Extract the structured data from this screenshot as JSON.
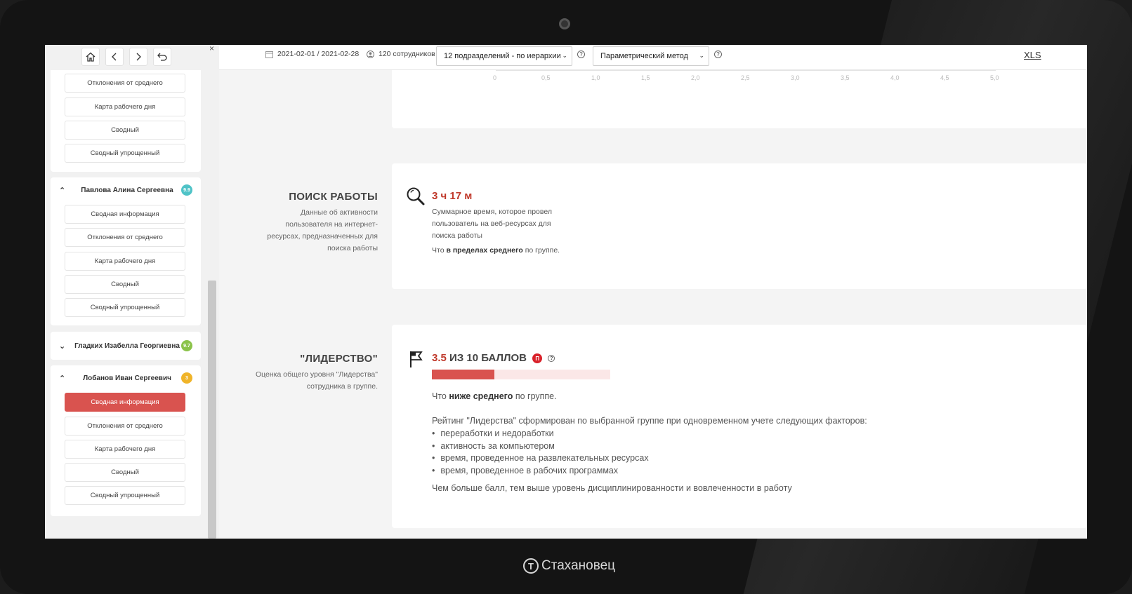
{
  "brand": {
    "name": "Стахановец"
  },
  "sidebar": {
    "cards": [
      {
        "items": [
          "Отклонения от среднего",
          "Карта рабочего дня",
          "Сводный",
          "Сводный упрощенный"
        ]
      },
      {
        "name": "Павлова Алина Сергеевна",
        "score": "9.9",
        "badge_color": "#4fc3c7",
        "expanded": true,
        "items": [
          "Сводная информация",
          "Отклонения от среднего",
          "Карта рабочего дня",
          "Сводный",
          "Сводный упрощенный"
        ]
      },
      {
        "name": "Гладких Изабелла Георгиевна",
        "score": "9.7",
        "badge_color": "#8bc34a",
        "expanded": false,
        "items": []
      },
      {
        "name": "Лобанов Иван Сергеевич",
        "score": "3",
        "badge_color": "#f0b429",
        "expanded": true,
        "items": [
          "Сводная информация",
          "Отклонения от среднего",
          "Карта рабочего дня",
          "Сводный",
          "Сводный упрощенный"
        ],
        "active_index": 0
      }
    ]
  },
  "topbar": {
    "period": "2021-02-01 / 2021-02-28",
    "employees": "120 сотрудников",
    "division_select": "12 подразделений - по иерархии",
    "method_select": "Параметрический метод",
    "export": "XLS"
  },
  "axis_ticks": [
    "0",
    "0,5",
    "1,0",
    "1,5",
    "2,0",
    "2,5",
    "3,0",
    "3,5",
    "4,0",
    "4,5",
    "5,0"
  ],
  "job_search": {
    "title": "ПОИСК РАБОТЫ",
    "description": "Данные об активности пользователя на интернет-ресурсах, предназначенных для поиска работы",
    "value": "3 ч 17 м",
    "value_desc": "Суммарное время, которое провел пользователь на веб-ресурсах для поиска работы",
    "comparison_prefix": "Что ",
    "comparison_bold": "в пределах среднего",
    "comparison_suffix": " по группе."
  },
  "leadership": {
    "title": "\"ЛИДЕРСТВО\"",
    "description": "Оценка общего уровня \"Лидерства\" сотрудника в группе.",
    "score": "3.5",
    "score_suffix": "ИЗ 10 БАЛЛОВ",
    "badge": "П",
    "score_value": 3.5,
    "score_max": 10,
    "comparison_prefix": "Что ",
    "comparison_bold": "ниже среднего",
    "comparison_suffix": " по группе.",
    "intro": "Рейтинг \"Лидерства\" сформирован по выбранной группе при одновременном учете следующих факторов:",
    "factors": [
      "переработки и недоработки",
      "активность за компьютером",
      "время, проведенное на развлекательных ресурсах",
      "время, проведенное в рабочих программах"
    ],
    "footer": "Чем больше балл, тем выше уровень дисциплинированности и вовлеченности в работу"
  }
}
